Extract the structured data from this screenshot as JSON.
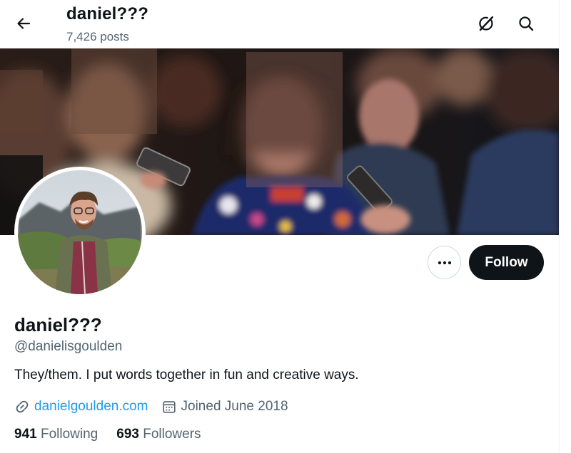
{
  "header": {
    "name": "daniel???",
    "posts_count": "7,426 posts"
  },
  "icons": {
    "back": "arrow-left-icon",
    "grok": "grok-icon",
    "search": "search-icon",
    "more": "more-dots-icon",
    "link": "link-icon",
    "calendar": "calendar-icon"
  },
  "profile": {
    "display_name": "daniel???",
    "handle": "@danielisgoulden",
    "bio": "They/them. I put words together in fun and creative ways.",
    "website": "danielgoulden.com",
    "joined": "Joined June 2018",
    "following_count": "941",
    "following_label": "Following",
    "followers_count": "693",
    "followers_label": "Followers"
  },
  "actions": {
    "follow_label": "Follow"
  },
  "colors": {
    "accent": "#1d9bf0",
    "text_primary": "#0f1419",
    "text_secondary": "#536471",
    "follow_bg": "#0f1419"
  }
}
